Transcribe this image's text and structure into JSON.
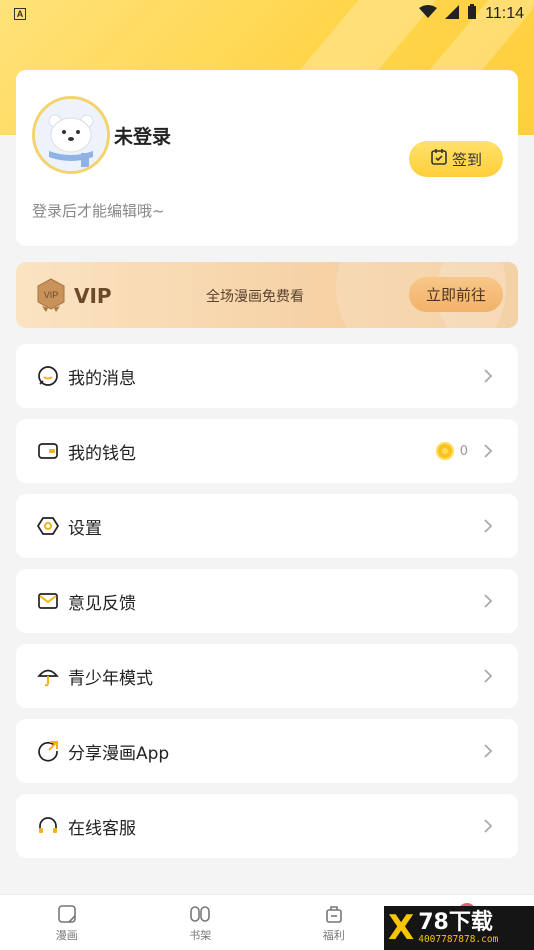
{
  "status_bar": {
    "time": "11:14",
    "notification_icon": "a-icon",
    "wifi": "wifi-icon",
    "signal": "signal-icon",
    "battery": "battery-icon"
  },
  "profile": {
    "avatar": "polar-bear-avatar",
    "username": "未登录",
    "checkin_label": "签到",
    "login_hint": "登录后才能编辑哦~"
  },
  "vip": {
    "badge_icon": "vip-badge-icon",
    "badge_text": "VIP",
    "title": "VIP",
    "description": "全场漫画免费看",
    "cta": "立即前往"
  },
  "menu": [
    {
      "label": "我的消息",
      "icon": "message-icon"
    },
    {
      "label": "我的钱包",
      "icon": "wallet-icon",
      "coin_count": "0"
    },
    {
      "label": "设置",
      "icon": "settings-icon"
    },
    {
      "label": "意见反馈",
      "icon": "mail-icon"
    },
    {
      "label": "青少年模式",
      "icon": "umbrella-icon"
    },
    {
      "label": "分享漫画App",
      "icon": "share-icon"
    },
    {
      "label": "在线客服",
      "icon": "headset-icon"
    }
  ],
  "tabs": [
    {
      "label": "漫画",
      "icon": "comic-icon"
    },
    {
      "label": "书架",
      "icon": "bookshelf-icon"
    },
    {
      "label": "福利",
      "icon": "gift-icon"
    },
    {
      "label": "",
      "icon": "profile-icon"
    }
  ],
  "watermark": {
    "mark": "X",
    "brand": "78下载",
    "phone": "4007787878.com"
  },
  "colors": {
    "accent": "#ffd54a",
    "vip_bg": "#f6d2a5",
    "badge": "#f25a7a"
  }
}
